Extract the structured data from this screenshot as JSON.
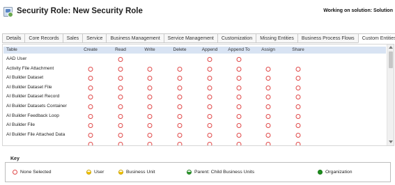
{
  "header": {
    "title": "Security Role: New Security Role",
    "solution_text": "Working on solution: Solution"
  },
  "tabs": [
    "Details",
    "Core Records",
    "Sales",
    "Service",
    "Business Management",
    "Service Management",
    "Customization",
    "Missing Entities",
    "Business Process Flows",
    "Custom Entities"
  ],
  "active_tab": "Custom Entities",
  "grid": {
    "columns": [
      "Table",
      "Create",
      "Read",
      "Write",
      "Delete",
      "Append",
      "Append To",
      "Assign",
      "Share"
    ],
    "rows": [
      {
        "name": "AAD User",
        "privileges": [
          "",
          "none",
          "",
          "",
          "none",
          "none",
          "",
          ""
        ]
      },
      {
        "name": "Activity File Attachment",
        "privileges": [
          "none",
          "none",
          "none",
          "none",
          "none",
          "none",
          "none",
          "none"
        ]
      },
      {
        "name": "AI Builder Dataset",
        "privileges": [
          "none",
          "none",
          "none",
          "none",
          "none",
          "none",
          "none",
          "none"
        ]
      },
      {
        "name": "AI Builder Dataset File",
        "privileges": [
          "none",
          "none",
          "none",
          "none",
          "none",
          "none",
          "none",
          "none"
        ]
      },
      {
        "name": "AI Builder Dataset Record",
        "privileges": [
          "none",
          "none",
          "none",
          "none",
          "none",
          "none",
          "none",
          "none"
        ]
      },
      {
        "name": "AI Builder Datasets Container",
        "privileges": [
          "none",
          "none",
          "none",
          "none",
          "none",
          "none",
          "none",
          "none"
        ]
      },
      {
        "name": "AI Builder Feedback Loop",
        "privileges": [
          "none",
          "none",
          "none",
          "none",
          "none",
          "none",
          "none",
          "none"
        ]
      },
      {
        "name": "AI Builder File",
        "privileges": [
          "none",
          "none",
          "none",
          "none",
          "none",
          "none",
          "none",
          "none"
        ]
      },
      {
        "name": "AI Builder File Attached Data",
        "privileges": [
          "none",
          "none",
          "none",
          "none",
          "none",
          "none",
          "none",
          "none"
        ]
      },
      {
        "name": "",
        "privileges": [
          "none",
          "none",
          "none",
          "none",
          "none",
          "none",
          "none",
          "none"
        ]
      }
    ]
  },
  "key": {
    "title": "Key",
    "items": [
      {
        "label": "None Selected",
        "symbol": "none"
      },
      {
        "label": "User",
        "symbol": "user"
      },
      {
        "label": "Business Unit",
        "symbol": "bu"
      },
      {
        "label": "Parent: Child Business Units",
        "symbol": "parent"
      },
      {
        "label": "Organization",
        "symbol": "org"
      }
    ]
  },
  "colors": {
    "header_bg": "#d8e3f3",
    "none_circle": "#e04848",
    "organization": "#1e8f1e",
    "user": "#f5c600"
  }
}
